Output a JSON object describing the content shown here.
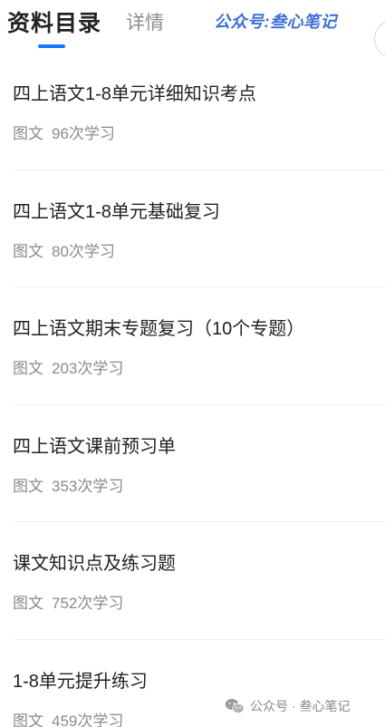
{
  "header": {
    "active_tab": "资料目录",
    "inactive_tab": "详情",
    "brand_text": "公众号:叁心笔记"
  },
  "items": [
    {
      "title": "四上语文1-8单元详细知识考点",
      "type": "图文",
      "views": "96次学习"
    },
    {
      "title": "四上语文1-8单元基础复习",
      "type": "图文",
      "views": "80次学习"
    },
    {
      "title": "四上语文期末专题复习（10个专题）",
      "type": "图文",
      "views": "203次学习"
    },
    {
      "title": "四上语文课前预习单",
      "type": "图文",
      "views": "353次学习"
    },
    {
      "title": "课文知识点及练习题",
      "type": "图文",
      "views": "752次学习"
    },
    {
      "title": "1-8单元提升练习",
      "type": "图文",
      "views": "459次学习"
    }
  ],
  "watermark": {
    "text": "公众号 · 叁心笔记",
    "icon": "wechat-icon"
  },
  "colors": {
    "accent": "#1677ff",
    "brand": "#3d6fd9",
    "title_text": "#222222",
    "meta_text": "#8a8a8a"
  }
}
